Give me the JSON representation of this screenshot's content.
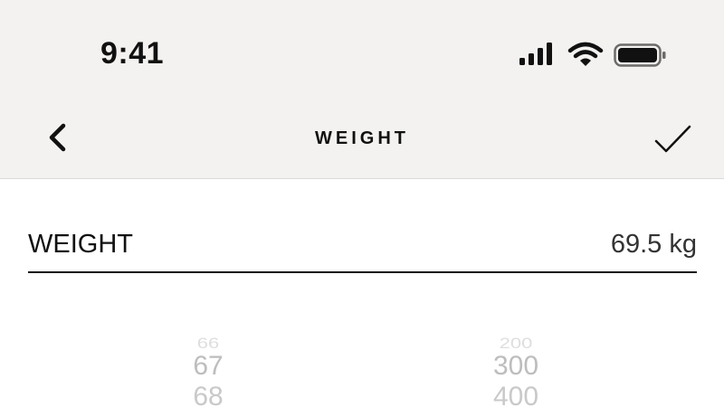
{
  "status_bar": {
    "time": "9:41",
    "icons": [
      "cellular-signal-icon",
      "wifi-icon",
      "battery-icon"
    ]
  },
  "nav": {
    "title": "WEIGHT",
    "back_icon": "chevron-left-icon",
    "confirm_icon": "checkmark-icon"
  },
  "field": {
    "label": "WEIGHT",
    "value": "69.5 kg"
  },
  "picker": {
    "left_column": [
      "66",
      "67",
      "68"
    ],
    "right_column": [
      "200",
      "300",
      "400"
    ]
  },
  "colors": {
    "header_bg": "#f4f2f0",
    "text": "#111111",
    "picker_inactive": "#c9c9c9"
  }
}
